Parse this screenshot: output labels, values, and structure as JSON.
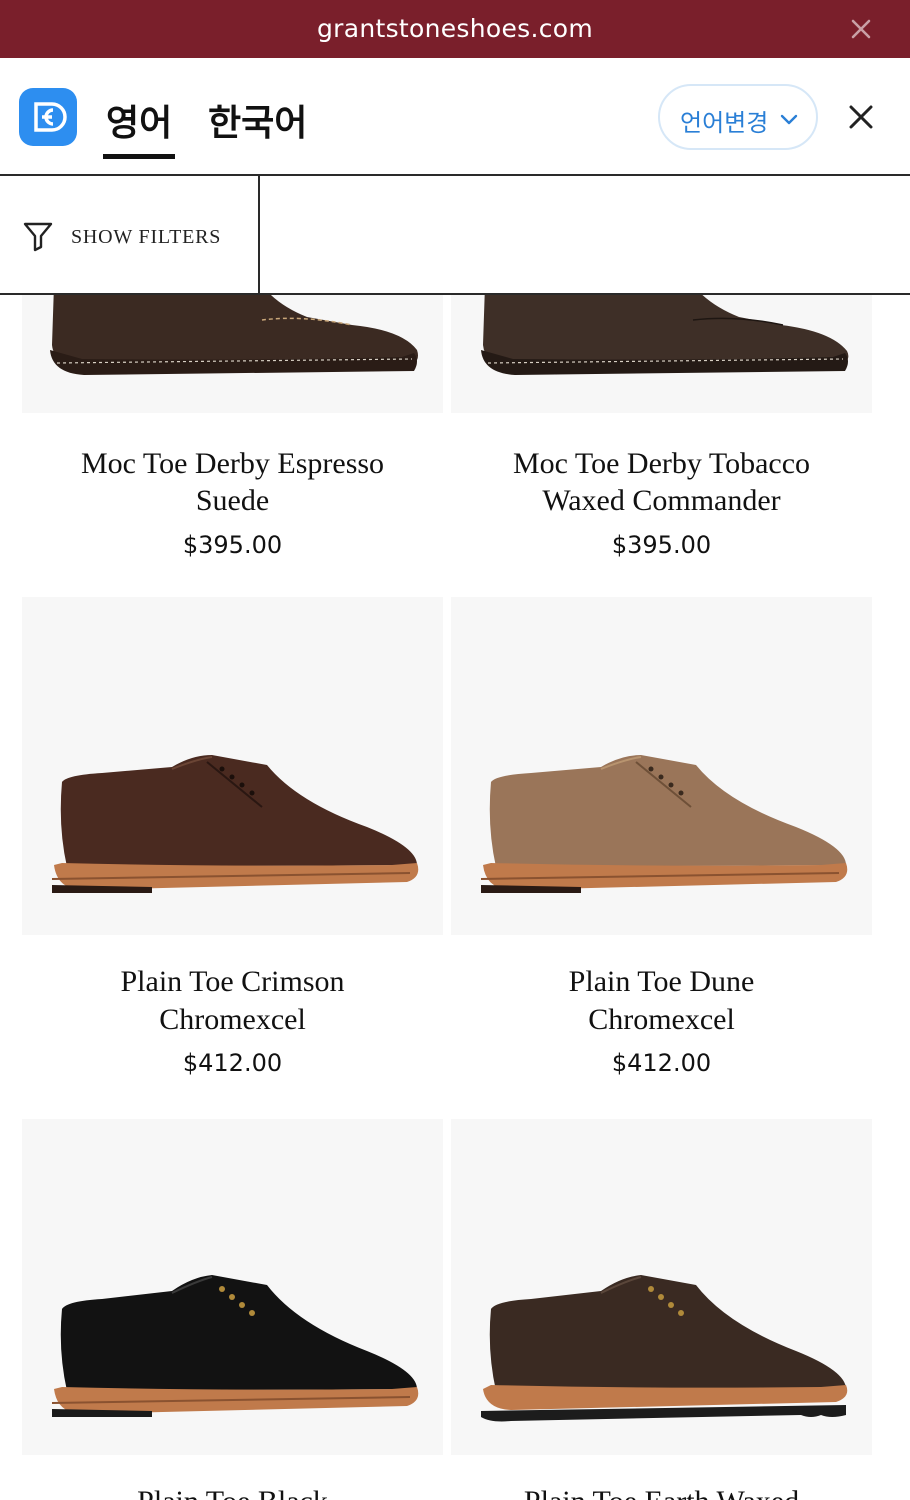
{
  "browser": {
    "url": "grantstoneshoes.com",
    "bar_color": "#7a1f2b"
  },
  "translator": {
    "tabs": [
      {
        "label": "영어",
        "active": true
      },
      {
        "label": "한국어",
        "active": false
      }
    ],
    "change_language_label": "언어변경",
    "accent": "#2d8ef0"
  },
  "filters": {
    "label": "SHOW FILTERS"
  },
  "products": [
    {
      "name": "Moc Toe Derby Espresso Suede",
      "line1": "Moc Toe Derby Espresso",
      "line2": "Suede",
      "price": "$395.00",
      "color": "#3b2a22"
    },
    {
      "name": "Moc Toe Derby Tobacco Waxed Commander",
      "line1": "Moc Toe Derby Tobacco",
      "line2": "Waxed Commander",
      "price": "$395.00",
      "color": "#3e2f27"
    },
    {
      "name": "Plain Toe Crimson Chromexcel",
      "line1": "Plain Toe Crimson",
      "line2": "Chromexcel",
      "price": "$412.00",
      "color": "#4a2a20"
    },
    {
      "name": "Plain Toe Dune Chromexcel",
      "line1": "Plain Toe Dune",
      "line2": "Chromexcel",
      "price": "$412.00",
      "color": "#9a7559"
    },
    {
      "name": "Plain Toe Black",
      "line1": "Plain Toe Black",
      "line2": "",
      "price": "",
      "color": "#121212"
    },
    {
      "name": "Plain Toe Earth Waxed",
      "line1": "Plain Toe Earth Waxed",
      "line2": "",
      "price": "",
      "color": "#3a2a22"
    }
  ]
}
